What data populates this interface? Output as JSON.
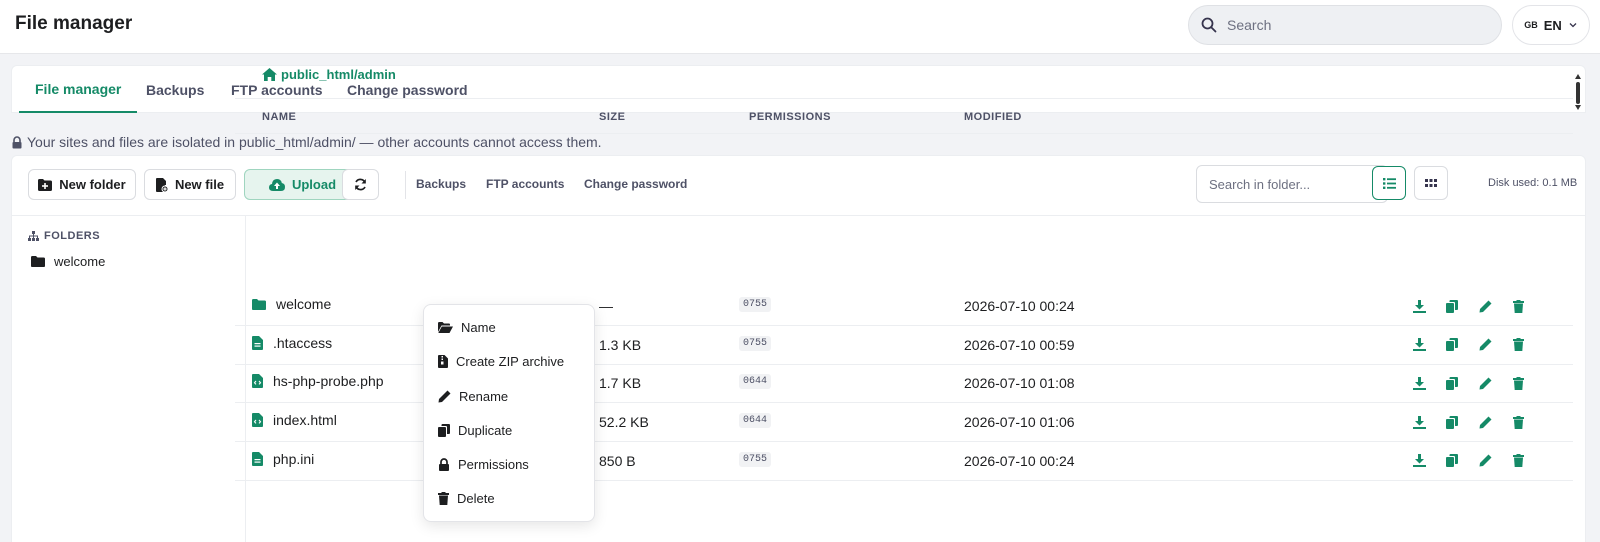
{
  "app": {
    "title": "File manager"
  },
  "search": {
    "placeholder": "Search"
  },
  "language": {
    "flag": "GB",
    "code": "EN"
  },
  "tabs": [
    {
      "label": "File manager",
      "active": true
    },
    {
      "label": "Backups",
      "active": false
    },
    {
      "label": "FTP accounts",
      "active": false
    },
    {
      "label": "Change password",
      "active": false
    }
  ],
  "notice": "Your sites and files are isolated in public_html/admin/ — other accounts cannot access them.",
  "toolbar": {
    "new_folder": "New folder",
    "new_file": "New file",
    "upload": "Upload",
    "links": [
      "Backups",
      "FTP accounts",
      "Change password"
    ],
    "folder_search_placeholder": "Search in folder...",
    "disk_used": "Disk used: 0.1 MB"
  },
  "sidebar": {
    "heading": "FOLDERS",
    "items": [
      {
        "label": "welcome"
      }
    ]
  },
  "breadcrumb": "public_html/admin",
  "table": {
    "headers": [
      "NAME",
      "SIZE",
      "PERMISSIONS",
      "MODIFIED"
    ],
    "rows": [
      {
        "name": "welcome",
        "type": "folder",
        "size": "—",
        "perms": "0755",
        "modified": "2026-07-10 00:24"
      },
      {
        "name": ".htaccess",
        "type": "file",
        "size": "1.3 KB",
        "perms": "0755",
        "modified": "2026-07-10 00:59"
      },
      {
        "name": "hs-php-probe.php",
        "type": "code",
        "size": "1.7 KB",
        "perms": "0644",
        "modified": "2026-07-10 01:08"
      },
      {
        "name": "index.html",
        "type": "code",
        "size": "52.2 KB",
        "perms": "0644",
        "modified": "2026-07-10 01:06"
      },
      {
        "name": "php.ini",
        "type": "file",
        "size": "850 B",
        "perms": "0755",
        "modified": "2026-07-10 00:24"
      }
    ]
  },
  "context_menu": {
    "items": [
      {
        "label": "Name",
        "icon": "folder-open-icon"
      },
      {
        "label": "Create ZIP archive",
        "icon": "zip-file-icon"
      },
      {
        "label": "Rename",
        "icon": "pencil-icon"
      },
      {
        "label": "Duplicate",
        "icon": "copy-icon"
      },
      {
        "label": "Permissions",
        "icon": "lock-icon"
      },
      {
        "label": "Delete",
        "icon": "trash-icon"
      }
    ]
  },
  "colors": {
    "accent": "#158a67",
    "text": "#1d1e20",
    "muted": "#4e5166"
  }
}
